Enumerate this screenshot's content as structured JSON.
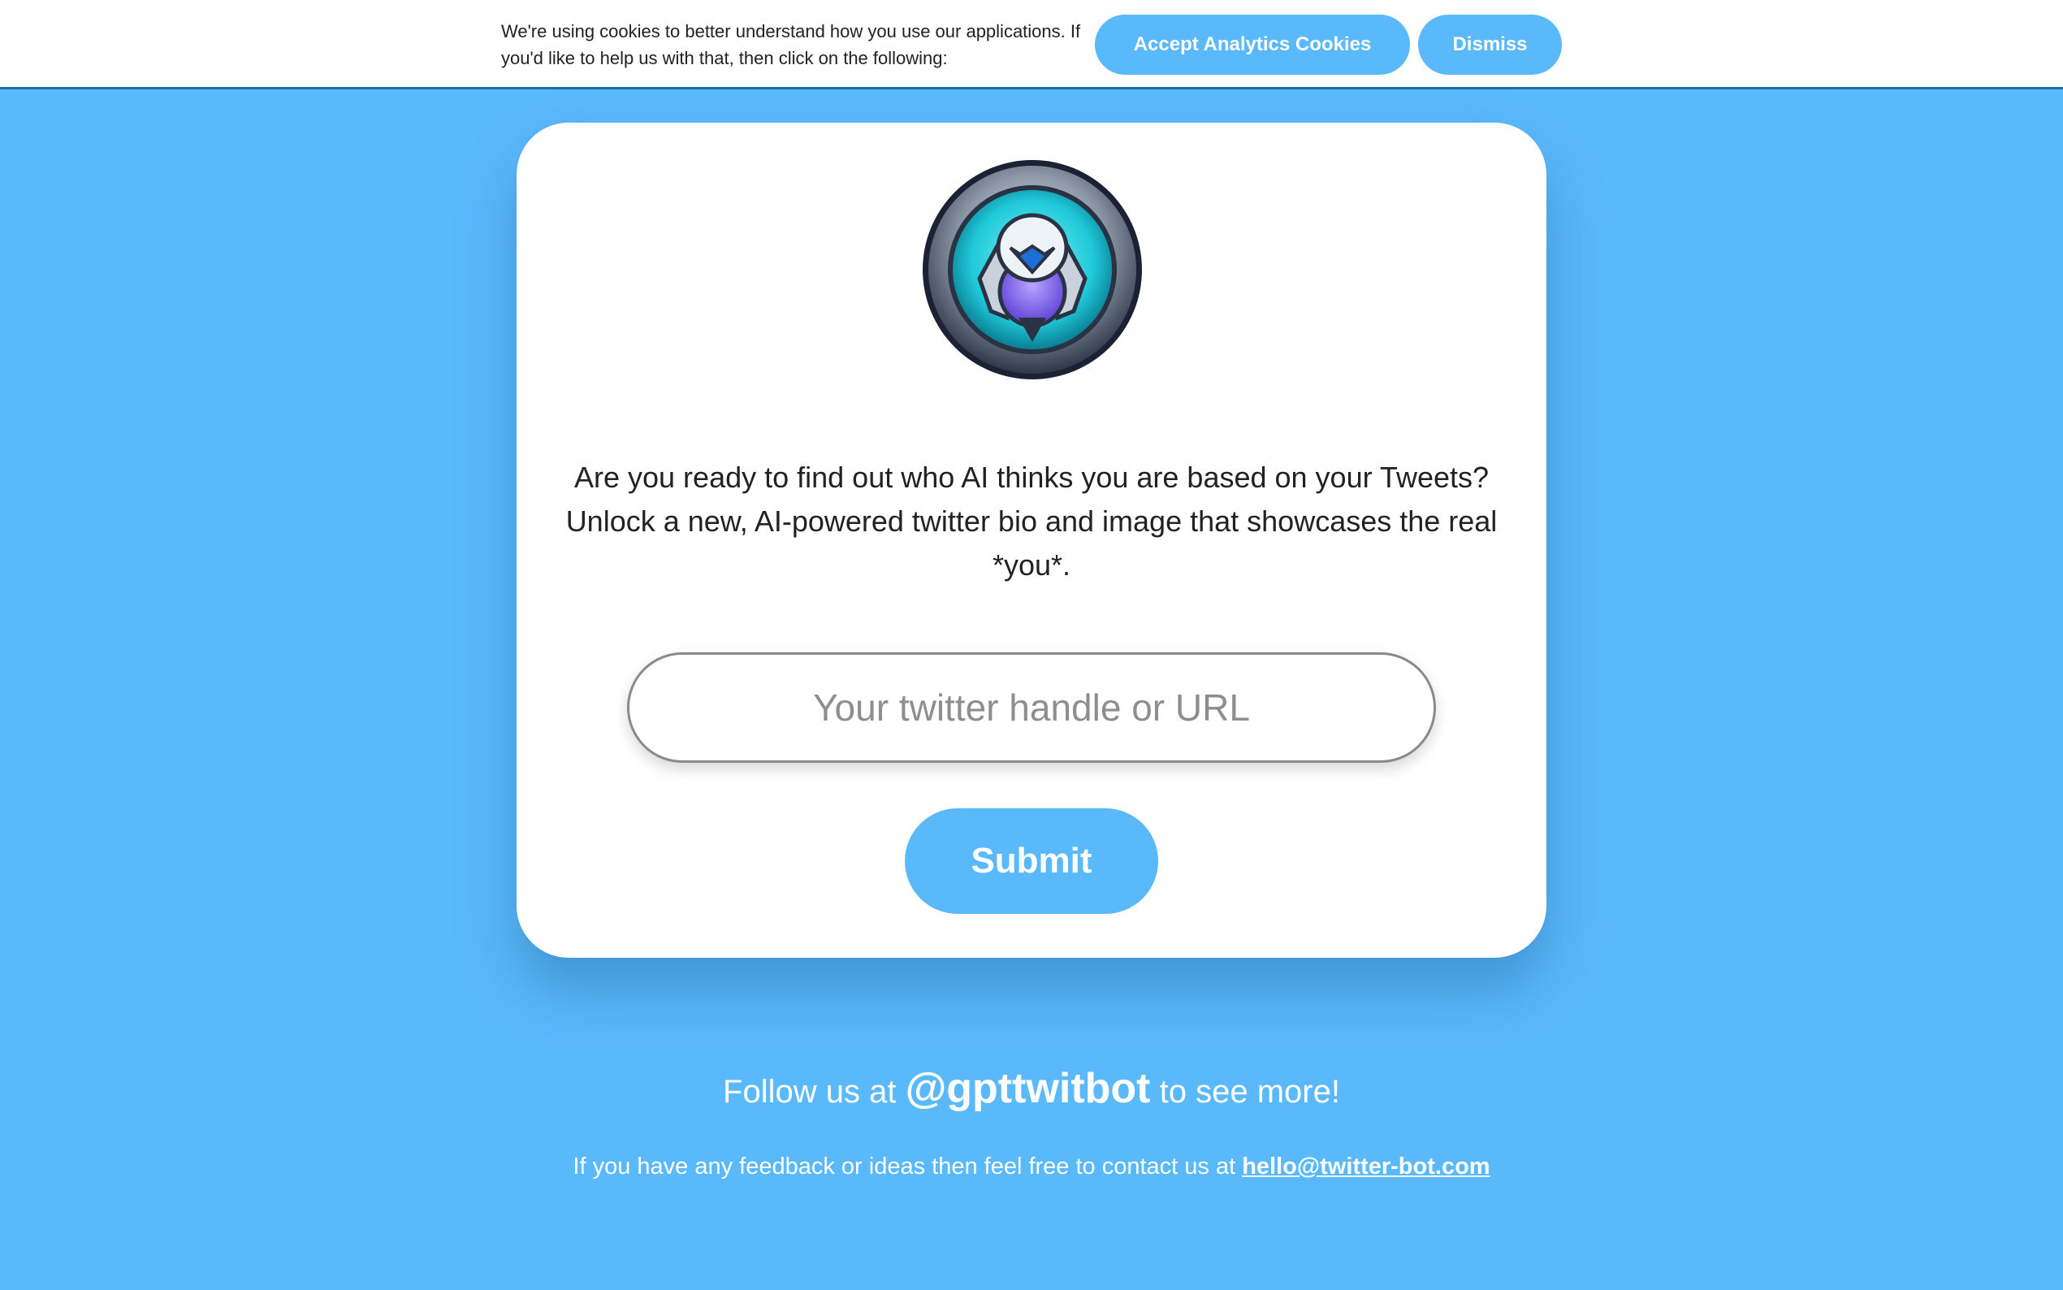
{
  "cookie_banner": {
    "message": "We're using cookies to better understand how you use our applications. If you'd like to help us with that, then click on the following:",
    "accept_label": "Accept Analytics Cookies",
    "dismiss_label": "Dismiss"
  },
  "card": {
    "logo_icon": "robot-bird-badge-icon",
    "intro": "Are you ready to find out who AI thinks you are based on your Tweets? Unlock a new, AI-powered twitter bio and image that showcases the real *you*.",
    "input_placeholder": "Your twitter handle or URL",
    "input_value": "",
    "submit_label": "Submit"
  },
  "footer": {
    "follow_prefix": "Follow us at ",
    "follow_handle": "@gpttwitbot",
    "follow_suffix": " to see more!",
    "feedback_text": "If you have any feedback or ideas then feel free to contact us at ",
    "feedback_email": "hello@twitter-bot.com"
  },
  "colors": {
    "background": "#5ab9fb",
    "button": "#5ab9fb",
    "banner_border": "#1f6aa8"
  }
}
